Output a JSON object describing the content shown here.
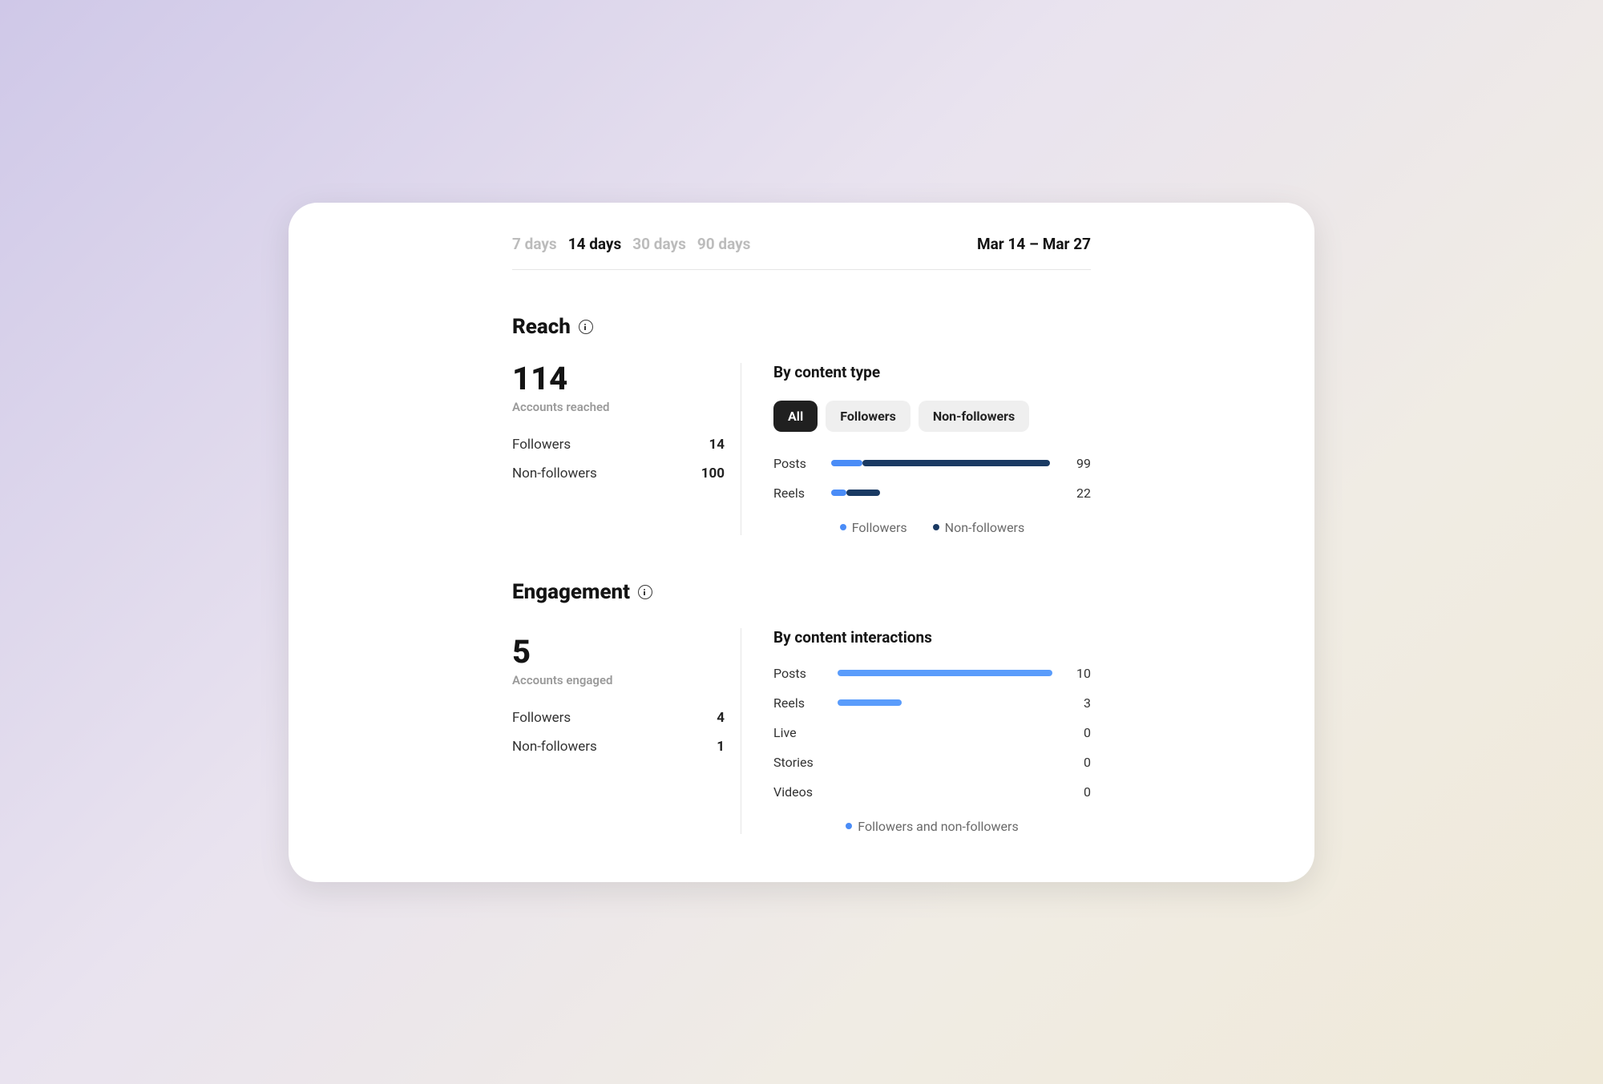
{
  "header": {
    "range_tabs": [
      "7 days",
      "14 days",
      "30 days",
      "90 days"
    ],
    "active_tab_index": 1,
    "date_range": "Mar 14 – Mar 27"
  },
  "reach": {
    "title": "Reach",
    "total": "114",
    "total_label": "Accounts reached",
    "followers_label": "Followers",
    "followers_value": "14",
    "nonfollowers_label": "Non-followers",
    "nonfollowers_value": "100",
    "by_content_type": {
      "title": "By content type",
      "filters": [
        "All",
        "Followers",
        "Non-followers"
      ],
      "active_filter_index": 0,
      "rows": [
        {
          "label": "Posts",
          "followers": 14,
          "nonfollowers": 85,
          "value": "99"
        },
        {
          "label": "Reels",
          "followers": 7,
          "nonfollowers": 15,
          "value": "22"
        }
      ],
      "legend_followers": "Followers",
      "legend_nonfollowers": "Non-followers"
    }
  },
  "engagement": {
    "title": "Engagement",
    "total": "5",
    "total_label": "Accounts engaged",
    "followers_label": "Followers",
    "followers_value": "4",
    "nonfollowers_label": "Non-followers",
    "nonfollowers_value": "1",
    "by_interactions": {
      "title": "By content interactions",
      "rows": [
        {
          "label": "Posts",
          "value": "10",
          "pct": 100
        },
        {
          "label": "Reels",
          "value": "3",
          "pct": 30
        },
        {
          "label": "Live",
          "value": "0",
          "pct": 0
        },
        {
          "label": "Stories",
          "value": "0",
          "pct": 0
        },
        {
          "label": "Videos",
          "value": "0",
          "pct": 0
        }
      ],
      "legend": "Followers and non-followers"
    }
  },
  "chart_data": [
    {
      "type": "bar",
      "title": "Reach – By content type",
      "categories": [
        "Posts",
        "Reels"
      ],
      "series": [
        {
          "name": "Followers",
          "values": [
            14,
            7
          ]
        },
        {
          "name": "Non-followers",
          "values": [
            85,
            15
          ]
        }
      ],
      "totals": [
        99,
        22
      ],
      "xlabel": "",
      "ylabel": "",
      "ylim": [
        0,
        100
      ]
    },
    {
      "type": "bar",
      "title": "Engagement – By content interactions",
      "categories": [
        "Posts",
        "Reels",
        "Live",
        "Stories",
        "Videos"
      ],
      "series": [
        {
          "name": "Followers and non-followers",
          "values": [
            10,
            3,
            0,
            0,
            0
          ]
        }
      ],
      "xlabel": "",
      "ylabel": "",
      "ylim": [
        0,
        10
      ]
    }
  ]
}
